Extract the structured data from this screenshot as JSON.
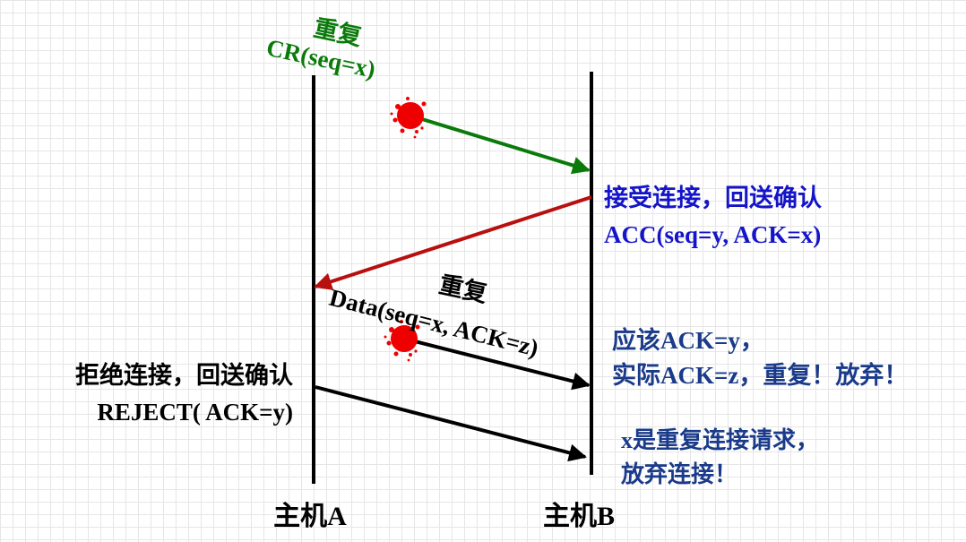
{
  "hosts": {
    "a": "主机A",
    "b": "主机B"
  },
  "messages": {
    "cr": {
      "tag": "重复",
      "label": "CR(seq=x)"
    },
    "acc": {
      "line1": "接受连接，回送确认",
      "line2": "ACC(seq=y, ACK=x)"
    },
    "data": {
      "tag": "重复",
      "label": "Data(seq=x, ACK=z)"
    },
    "reject": {
      "line1": "拒绝连接，回送确认",
      "line2": "REJECT( ACK=y)"
    }
  },
  "notes": {
    "check1": "应该ACK=y，",
    "check2": "实际ACK=z，重复！放弃！",
    "conclude1": "x是重复连接请求，",
    "conclude2": "放弃连接！"
  },
  "colors": {
    "cr": "#0a7a0a",
    "acc_arrow": "#b80f0f",
    "acc_text": "#1414c8",
    "data": "#000000",
    "note_text": "#1a3a8a",
    "burst": "#ee0000",
    "timeline": "#000000"
  }
}
